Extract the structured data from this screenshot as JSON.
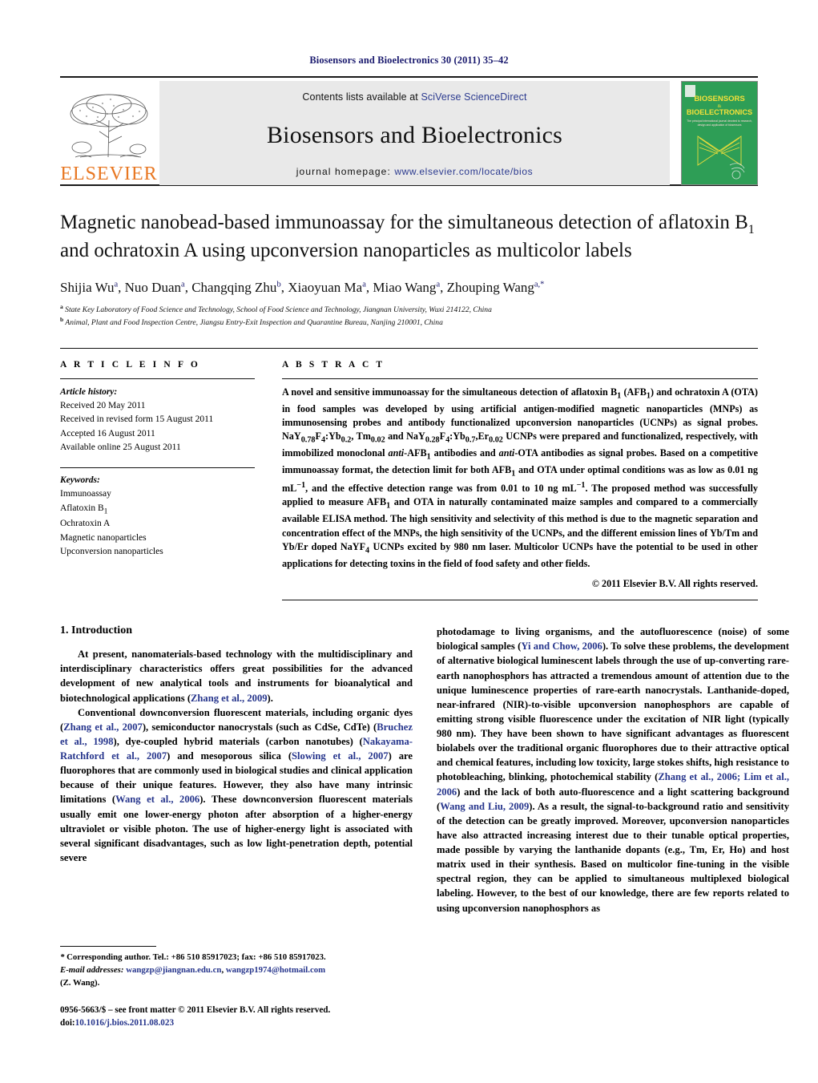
{
  "running_head": "Biosensors and Bioelectronics 30 (2011) 35–42",
  "masthead": {
    "publisher_logo_text": "ELSEVIER",
    "contents_prefix": "Contents lists available at ",
    "contents_link": "SciVerse ScienceDirect",
    "journal_name": "Biosensors and Bioelectronics",
    "homepage_prefix": "journal homepage: ",
    "homepage_url": "www.elsevier.com/locate/bios",
    "cover": {
      "line1": "BIOSENSORS",
      "amp": "&",
      "line2": "BIOELECTRONICS",
      "tagline": "The principal international journal devoted to research, design, development and application of biosensors and bioelectronics",
      "bg_color": "#2e9e56"
    }
  },
  "article": {
    "title_part1": "Magnetic nanobead-based immunoassay for the simultaneous detection of aflatoxin B",
    "title_sub": "1",
    "title_part2": " and ochratoxin A using upconversion nanoparticles as multicolor labels",
    "authors": [
      {
        "name": "Shijia Wu",
        "sup": "a"
      },
      {
        "name": "Nuo Duan",
        "sup": "a"
      },
      {
        "name": "Changqing Zhu",
        "sup": "b"
      },
      {
        "name": "Xiaoyuan Ma",
        "sup": "a"
      },
      {
        "name": "Miao Wang",
        "sup": "a"
      },
      {
        "name": "Zhouping Wang",
        "sup": "a,*"
      }
    ],
    "affiliations": [
      {
        "marker": "a",
        "text": "State Key Laboratory of Food Science and Technology, School of Food Science and Technology, Jiangnan University, Wuxi 214122, China"
      },
      {
        "marker": "b",
        "text": "Animal, Plant and Food Inspection Centre, Jiangsu Entry-Exit Inspection and Quarantine Bureau, Nanjing 210001, China"
      }
    ]
  },
  "article_info": {
    "heading": "A R T I C L E    I N F O",
    "history_heading": "Article history:",
    "history": [
      "Received 20 May 2011",
      "Received in revised form 15 August 2011",
      "Accepted 16 August 2011",
      "Available online 25 August 2011"
    ],
    "keywords_heading": "Keywords:",
    "keywords": [
      "Immunoassay",
      "Aflatoxin B1",
      "Ochratoxin A",
      "Magnetic nanoparticles",
      "Upconversion nanoparticles"
    ]
  },
  "abstract": {
    "heading": "A B S T R A C T",
    "text_html": "A novel and sensitive immunoassay for the simultaneous detection of aflatoxin B<sub>1</sub> (AFB<sub>1</sub>) and ochratoxin A (OTA) in food samples was developed by using artificial antigen-modified magnetic nanoparticles (MNPs) as immunosensing probes and antibody functionalized upconversion nanoparticles (UCNPs) as signal probes. NaY<sub>0.78</sub>F<sub>4</sub>:Yb<sub>0.2</sub>, Tm<sub>0.02</sub> and NaY<sub>0.28</sub>F<sub>4</sub>:Yb<sub>0.7</sub>,Er<sub>0.02</sub> UCNPs were prepared and functionalized, respectively, with immobilized monoclonal <i>anti</i>-AFB<sub>1</sub> antibodies and <i>anti</i>-OTA antibodies as signal probes. Based on a competitive immunoassay format, the detection limit for both AFB<sub>1</sub> and OTA under optimal conditions was as low as 0.01 ng mL<sup>−1</sup>, and the effective detection range was from 0.01 to 10 ng mL<sup>−1</sup>. The proposed method was successfully applied to measure AFB<sub>1</sub> and OTA in naturally contaminated maize samples and compared to a commercially available ELISA method. The high sensitivity and selectivity of this method is due to the magnetic separation and concentration effect of the MNPs, the high sensitivity of the UCNPs, and the different emission lines of Yb/Tm and Yb/Er doped NaYF<sub>4</sub> UCNPs excited by 980 nm laser. Multicolor UCNPs have the potential to be used in other applications for detecting toxins in the field of food safety and other fields.",
    "copyright": "© 2011 Elsevier B.V. All rights reserved."
  },
  "introduction": {
    "heading": "1.  Introduction",
    "left_paragraphs_html": [
      "At present, nanomaterials-based technology with the multidisciplinary and interdisciplinary characteristics offers great possibilities for the advanced development of new analytical tools and instruments for bioanalytical and biotechnological applications (<span class=\"ref\">Zhang et al., 2009</span>).",
      "Conventional downconversion fluorescent materials, including organic dyes (<span class=\"ref\">Zhang et al., 2007</span>), semiconductor nanocrystals (such as CdSe, CdTe) (<span class=\"ref\">Bruchez et al., 1998</span>), dye-coupled hybrid materials (carbon nanotubes) (<span class=\"ref\">Nakayama-Ratchford et al., 2007</span>) and mesoporous silica (<span class=\"ref\">Slowing et al., 2007</span>) are fluorophores that are commonly used in biological studies and clinical application because of their unique features. However, they also have many intrinsic limitations (<span class=\"ref\">Wang et al., 2006</span>). These downconversion fluorescent materials usually emit one lower-energy photon after absorption of a higher-energy ultraviolet or visible photon. The use of higher-energy light is associated with several significant disadvantages, such as low light-penetration depth, potential severe"
    ],
    "right_paragraphs_html": [
      "photodamage to living organisms, and the autofluorescence (noise) of some biological samples (<span class=\"ref\">Yi and Chow, 2006</span>). To solve these problems, the development of alternative biological luminescent labels through the use of up-converting rare-earth nanophosphors has attracted a tremendous amount of attention due to the unique luminescence properties of rare-earth nanocrystals. Lanthanide-doped, near-infrared (NIR)-to-visible upconversion nanophosphors are capable of emitting strong visible fluorescence under the excitation of NIR light (typically 980 nm). They have been shown to have significant advantages as fluorescent biolabels over the traditional organic fluorophores due to their attractive optical and chemical features, including low toxicity, large stokes shifts, high resistance to photobleaching, blinking, photochemical stability (<span class=\"ref\">Zhang et al., 2006; Lim et al., 2006</span>) and the lack of both auto-fluorescence and a light scattering background (<span class=\"ref\">Wang and Liu, 2009</span>). As a result, the signal-to-background ratio and sensitivity of the detection can be greatly improved. Moreover, upconversion nanoparticles have also attracted increasing interest due to their tunable optical properties, made possible by varying the lanthanide dopants (e.g., Tm, Er, Ho) and host matrix used in their synthesis. Based on multicolor fine-tuning in the visible spectral region, they can be applied to simultaneous multiplexed biological labeling. However, to the best of our knowledge, there are few reports related to using upconversion nanophosphors as"
    ]
  },
  "footnote": {
    "corresponding_html": "<span class=\"em\">*</span>  Corresponding author. Tel.: +86 510 85917023; fax: +86 510 85917023.",
    "email_label": "E-mail addresses:",
    "email1": "wangzp@jiangnan.edu.cn",
    "email2": "wangzp1974@hotmail.com",
    "email_owner": "(Z. Wang).",
    "issn_line": "0956-5663/$ – see front matter © 2011 Elsevier B.V. All rights reserved.",
    "doi_label": "doi:",
    "doi_value": "10.1016/j.bios.2011.08.023"
  },
  "colors": {
    "link_blue": "#26358c",
    "running_head_blue": "#1a1a6e",
    "elsevier_orange": "#e87722",
    "band_gray": "#e9e9e9",
    "cover_green": "#2e9e56"
  }
}
